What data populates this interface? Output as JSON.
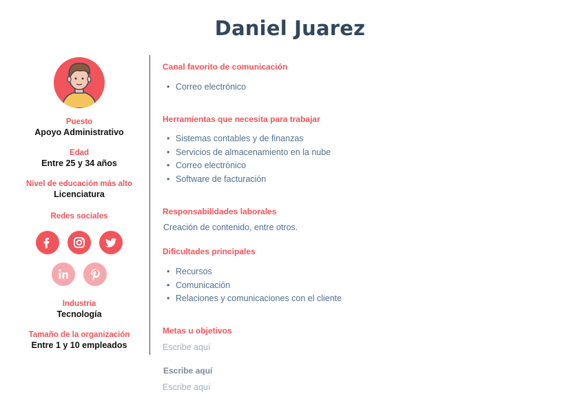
{
  "persona": {
    "name": "Daniel Juarez"
  },
  "sidebar": {
    "fields": [
      {
        "label": "Puesto",
        "value": "Apoyo Administrativo"
      },
      {
        "label": "Edad",
        "value": "Entre 25 y 34 años"
      },
      {
        "label": "Nivel de educación más alto",
        "value": "Licenciatura"
      }
    ],
    "social_label": "Redes sociales",
    "social_icons": [
      "facebook-icon",
      "instagram-icon",
      "twitter-icon",
      "linkedin-icon",
      "pinterest-icon"
    ],
    "fields_bottom": [
      {
        "label": "Industria",
        "value": "Tecnología"
      },
      {
        "label": "Tamaño de la organización",
        "value": "Entre 1 y 10 empleados"
      }
    ]
  },
  "main": {
    "communication": {
      "label": "Canal favorito de comunicación",
      "items": [
        "Correo electrónico"
      ]
    },
    "tools": {
      "label": "Herramientas que necesita para trabajar",
      "items": [
        "Sistemas contables y de finanzas",
        "Servicios de almacenamiento en la nube",
        "Correo electrónico",
        "Software de facturación"
      ]
    },
    "responsibilities": {
      "label": "Responsabilidades laborales",
      "text": "Creación de contenido, entre otros."
    },
    "challenges": {
      "label": "Dificultades principales",
      "items": [
        "Recursos",
        "Comunicación",
        "Relaciones y comunicaciones con el cliente"
      ]
    },
    "goals": {
      "label": "Metas u objetivos",
      "placeholder": "Escribe aquí"
    },
    "extra": {
      "label": "Escribe aquí",
      "placeholder": "Escribe aquí"
    }
  },
  "colors": {
    "accent": "#f2545b",
    "accent_faded": "#f6a8ad",
    "heading": "#33475b",
    "body_text": "#516f90",
    "placeholder": "#9fb0c0"
  }
}
